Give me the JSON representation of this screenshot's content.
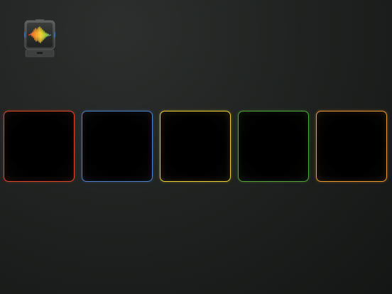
{
  "app": {
    "icon": "audio-waveform-icon"
  },
  "pads": [
    {
      "id": "pad-red",
      "color": "#e0482e"
    },
    {
      "id": "pad-blue",
      "color": "#4f82c8"
    },
    {
      "id": "pad-yellow",
      "color": "#f0d13a"
    },
    {
      "id": "pad-green",
      "color": "#55a63c"
    },
    {
      "id": "pad-orange",
      "color": "#f29a2e"
    }
  ]
}
